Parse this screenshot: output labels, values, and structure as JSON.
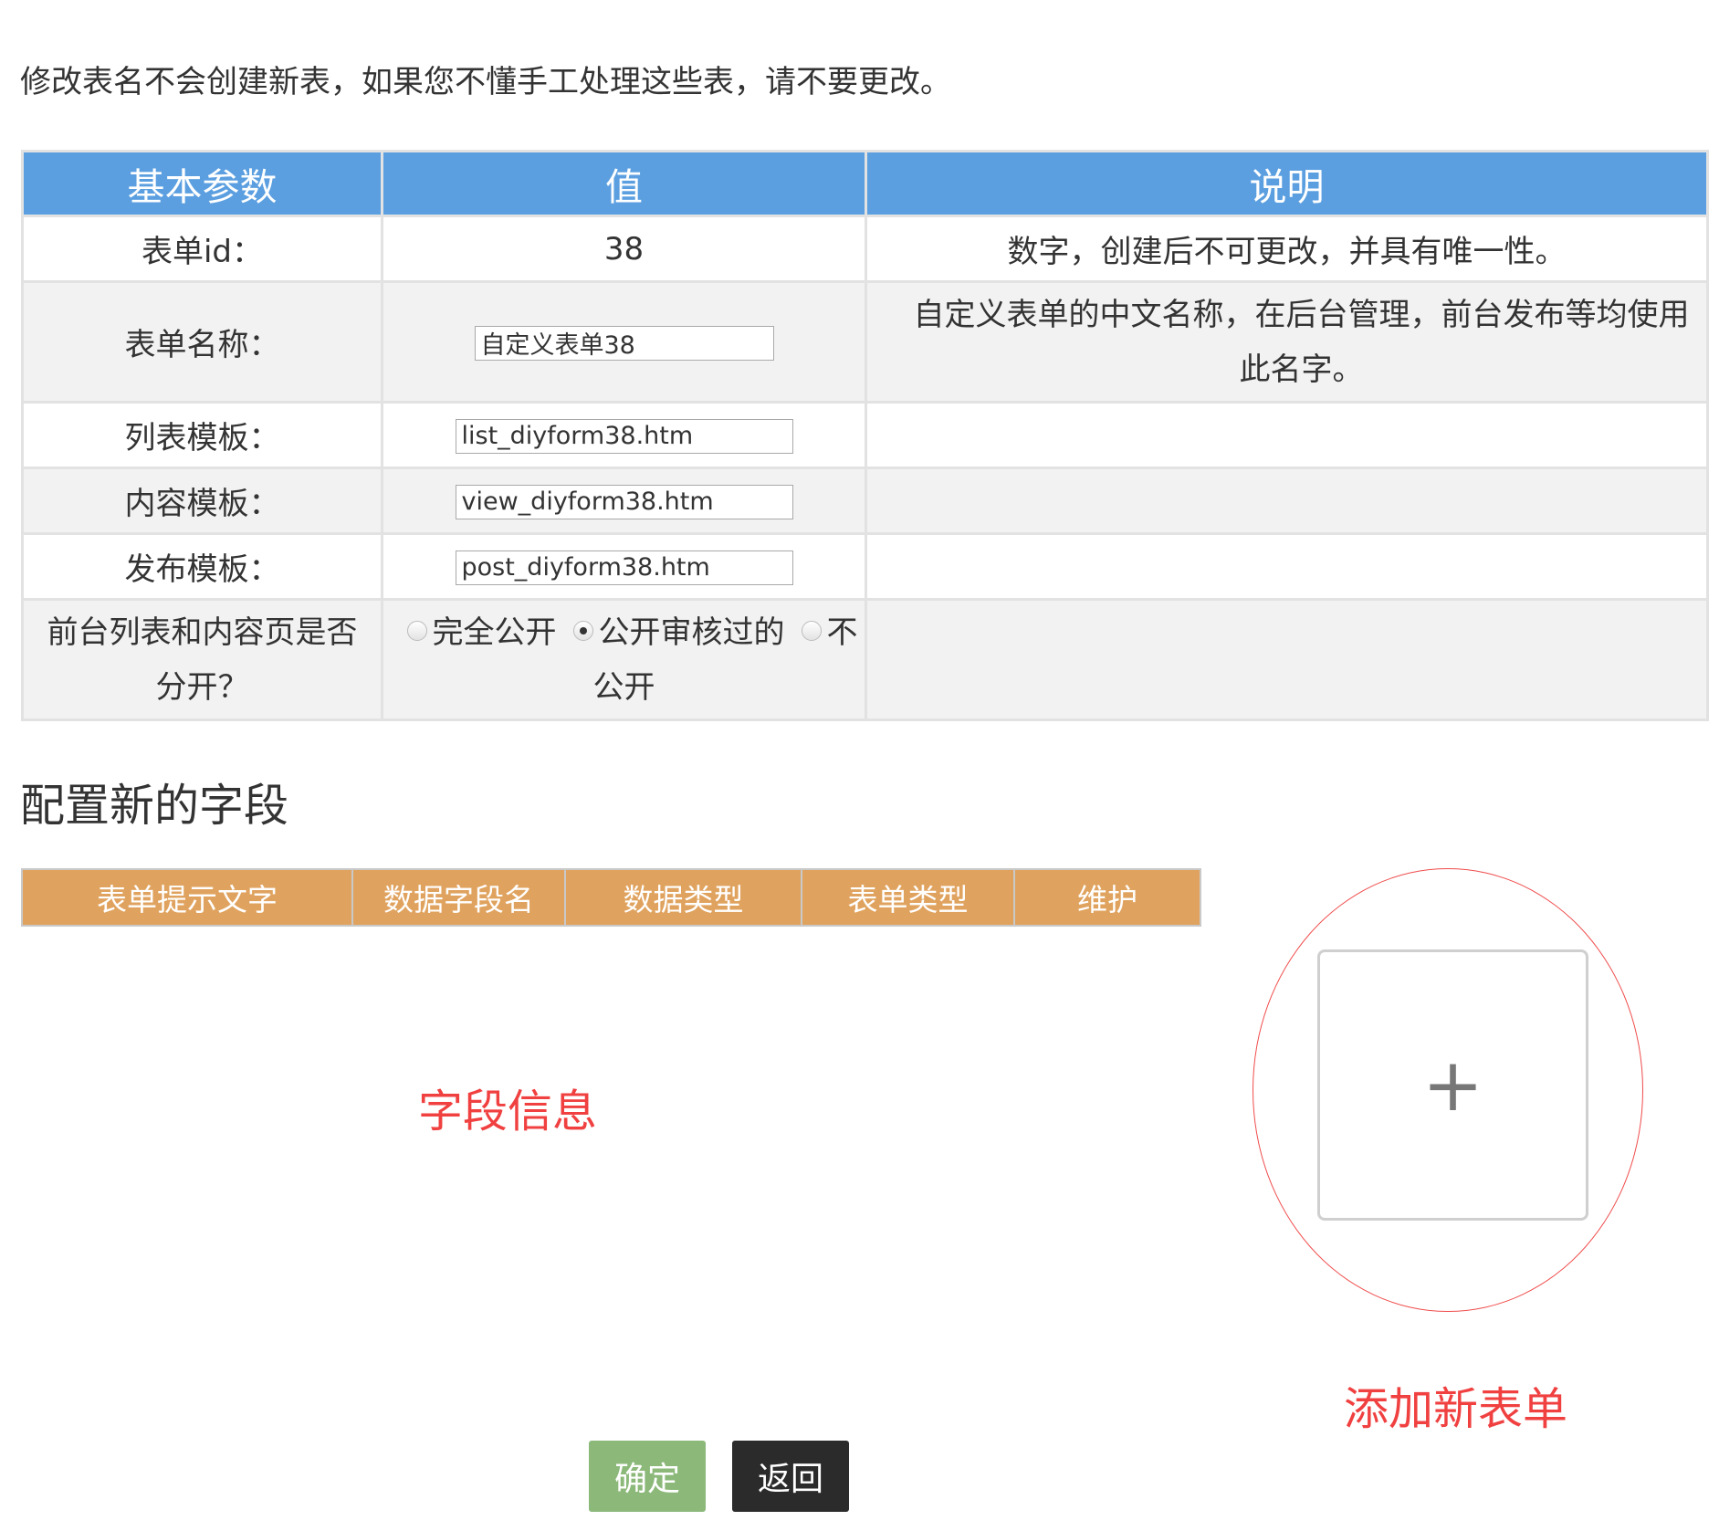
{
  "notice": "修改表名不会创建新表，如果您不懂手工处理这些表，请不要更改。",
  "params_table": {
    "headers": [
      "基本参数",
      "值",
      "说明"
    ],
    "form_id": {
      "label": "表单id：",
      "value": "38",
      "desc": "数字，创建后不可更改，并具有唯一性。"
    },
    "form_name": {
      "label": "表单名称：",
      "value": "自定义表单38",
      "desc": "自定义表单的中文名称，在后台管理，前台发布等均使用此名字。"
    },
    "list_template": {
      "label": "列表模板：",
      "value": "list_diyform38.htm"
    },
    "view_template": {
      "label": "内容模板：",
      "value": "view_diyform38.htm"
    },
    "post_template": {
      "label": "发布模板：",
      "value": "post_diyform38.htm"
    },
    "public": {
      "label": "前台列表和内容页是否分开？",
      "options": [
        "完全公开",
        "公开审核过的",
        "不公开"
      ],
      "selected": "公开审核过的"
    }
  },
  "section_title": "配置新的字段",
  "fields_table": {
    "headers": [
      "表单提示文字",
      "数据字段名",
      "数据类型",
      "表单类型",
      "维护"
    ]
  },
  "annotations": {
    "field_info": "字段信息",
    "add_new_form": "添加新表单"
  },
  "add_button": {
    "icon": "plus-icon"
  },
  "buttons": {
    "ok": "确定",
    "back": "返回"
  },
  "colors": {
    "header_blue": "#5b9fe0",
    "header_orange": "#e0a35f",
    "ok_green": "#8cb97a",
    "back_dark": "#2b2b2b",
    "annotation_red": "#f04040"
  }
}
